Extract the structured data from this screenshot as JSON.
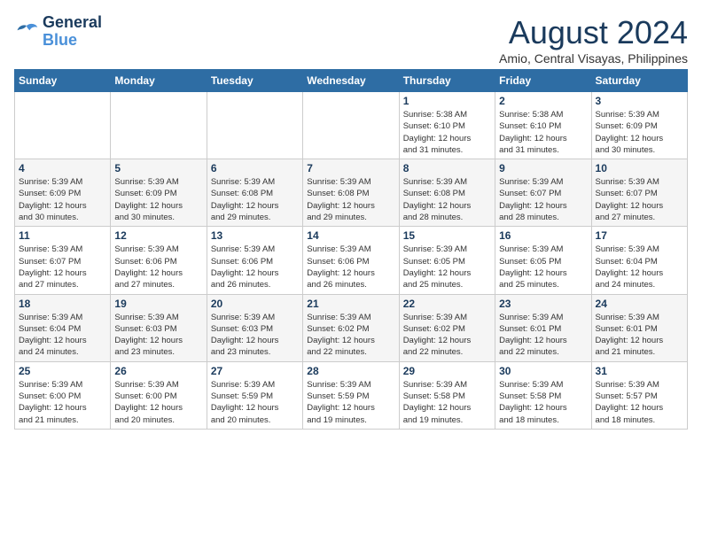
{
  "logo": {
    "line1": "General",
    "line2": "Blue"
  },
  "title": "August 2024",
  "subtitle": "Amio, Central Visayas, Philippines",
  "weekdays": [
    "Sunday",
    "Monday",
    "Tuesday",
    "Wednesday",
    "Thursday",
    "Friday",
    "Saturday"
  ],
  "weeks": [
    [
      {
        "day": "",
        "info": ""
      },
      {
        "day": "",
        "info": ""
      },
      {
        "day": "",
        "info": ""
      },
      {
        "day": "",
        "info": ""
      },
      {
        "day": "1",
        "info": "Sunrise: 5:38 AM\nSunset: 6:10 PM\nDaylight: 12 hours\nand 31 minutes."
      },
      {
        "day": "2",
        "info": "Sunrise: 5:38 AM\nSunset: 6:10 PM\nDaylight: 12 hours\nand 31 minutes."
      },
      {
        "day": "3",
        "info": "Sunrise: 5:39 AM\nSunset: 6:09 PM\nDaylight: 12 hours\nand 30 minutes."
      }
    ],
    [
      {
        "day": "4",
        "info": "Sunrise: 5:39 AM\nSunset: 6:09 PM\nDaylight: 12 hours\nand 30 minutes."
      },
      {
        "day": "5",
        "info": "Sunrise: 5:39 AM\nSunset: 6:09 PM\nDaylight: 12 hours\nand 30 minutes."
      },
      {
        "day": "6",
        "info": "Sunrise: 5:39 AM\nSunset: 6:08 PM\nDaylight: 12 hours\nand 29 minutes."
      },
      {
        "day": "7",
        "info": "Sunrise: 5:39 AM\nSunset: 6:08 PM\nDaylight: 12 hours\nand 29 minutes."
      },
      {
        "day": "8",
        "info": "Sunrise: 5:39 AM\nSunset: 6:08 PM\nDaylight: 12 hours\nand 28 minutes."
      },
      {
        "day": "9",
        "info": "Sunrise: 5:39 AM\nSunset: 6:07 PM\nDaylight: 12 hours\nand 28 minutes."
      },
      {
        "day": "10",
        "info": "Sunrise: 5:39 AM\nSunset: 6:07 PM\nDaylight: 12 hours\nand 27 minutes."
      }
    ],
    [
      {
        "day": "11",
        "info": "Sunrise: 5:39 AM\nSunset: 6:07 PM\nDaylight: 12 hours\nand 27 minutes."
      },
      {
        "day": "12",
        "info": "Sunrise: 5:39 AM\nSunset: 6:06 PM\nDaylight: 12 hours\nand 27 minutes."
      },
      {
        "day": "13",
        "info": "Sunrise: 5:39 AM\nSunset: 6:06 PM\nDaylight: 12 hours\nand 26 minutes."
      },
      {
        "day": "14",
        "info": "Sunrise: 5:39 AM\nSunset: 6:06 PM\nDaylight: 12 hours\nand 26 minutes."
      },
      {
        "day": "15",
        "info": "Sunrise: 5:39 AM\nSunset: 6:05 PM\nDaylight: 12 hours\nand 25 minutes."
      },
      {
        "day": "16",
        "info": "Sunrise: 5:39 AM\nSunset: 6:05 PM\nDaylight: 12 hours\nand 25 minutes."
      },
      {
        "day": "17",
        "info": "Sunrise: 5:39 AM\nSunset: 6:04 PM\nDaylight: 12 hours\nand 24 minutes."
      }
    ],
    [
      {
        "day": "18",
        "info": "Sunrise: 5:39 AM\nSunset: 6:04 PM\nDaylight: 12 hours\nand 24 minutes."
      },
      {
        "day": "19",
        "info": "Sunrise: 5:39 AM\nSunset: 6:03 PM\nDaylight: 12 hours\nand 23 minutes."
      },
      {
        "day": "20",
        "info": "Sunrise: 5:39 AM\nSunset: 6:03 PM\nDaylight: 12 hours\nand 23 minutes."
      },
      {
        "day": "21",
        "info": "Sunrise: 5:39 AM\nSunset: 6:02 PM\nDaylight: 12 hours\nand 22 minutes."
      },
      {
        "day": "22",
        "info": "Sunrise: 5:39 AM\nSunset: 6:02 PM\nDaylight: 12 hours\nand 22 minutes."
      },
      {
        "day": "23",
        "info": "Sunrise: 5:39 AM\nSunset: 6:01 PM\nDaylight: 12 hours\nand 22 minutes."
      },
      {
        "day": "24",
        "info": "Sunrise: 5:39 AM\nSunset: 6:01 PM\nDaylight: 12 hours\nand 21 minutes."
      }
    ],
    [
      {
        "day": "25",
        "info": "Sunrise: 5:39 AM\nSunset: 6:00 PM\nDaylight: 12 hours\nand 21 minutes."
      },
      {
        "day": "26",
        "info": "Sunrise: 5:39 AM\nSunset: 6:00 PM\nDaylight: 12 hours\nand 20 minutes."
      },
      {
        "day": "27",
        "info": "Sunrise: 5:39 AM\nSunset: 5:59 PM\nDaylight: 12 hours\nand 20 minutes."
      },
      {
        "day": "28",
        "info": "Sunrise: 5:39 AM\nSunset: 5:59 PM\nDaylight: 12 hours\nand 19 minutes."
      },
      {
        "day": "29",
        "info": "Sunrise: 5:39 AM\nSunset: 5:58 PM\nDaylight: 12 hours\nand 19 minutes."
      },
      {
        "day": "30",
        "info": "Sunrise: 5:39 AM\nSunset: 5:58 PM\nDaylight: 12 hours\nand 18 minutes."
      },
      {
        "day": "31",
        "info": "Sunrise: 5:39 AM\nSunset: 5:57 PM\nDaylight: 12 hours\nand 18 minutes."
      }
    ]
  ]
}
